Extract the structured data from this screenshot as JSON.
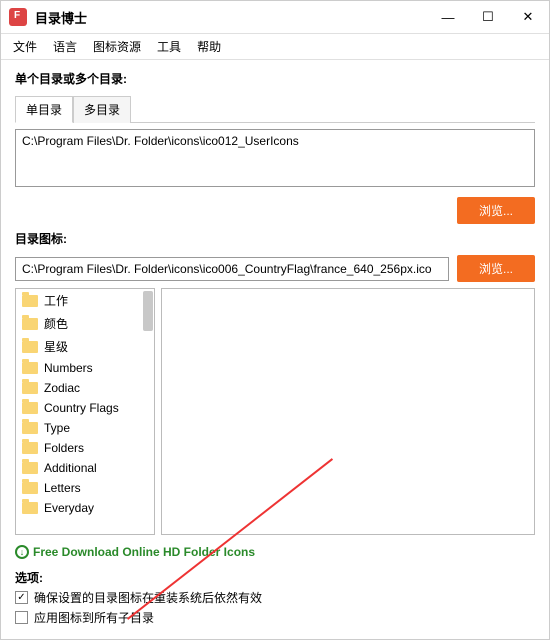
{
  "title": "目录博士",
  "menu": [
    "文件",
    "语言",
    "图标资源",
    "工具",
    "帮助"
  ],
  "section1_label": "单个目录或多个目录:",
  "tabs": [
    "单目录",
    "多目录"
  ],
  "path_input": "C:\\Program Files\\Dr. Folder\\icons\\ico012_UserIcons",
  "browse_label": "浏览...",
  "section2_label": "目录图标:",
  "icon_path": "C:\\Program Files\\Dr. Folder\\icons\\ico006_CountryFlag\\france_640_256px.ico",
  "categories": [
    "工作",
    "颜色",
    "星级",
    "Numbers",
    "Zodiac",
    "Country Flags",
    "Type",
    "Folders",
    "Additional",
    "Letters",
    "Everyday"
  ],
  "download_link": "Free Download Online HD Folder Icons",
  "options_label": "选项:",
  "opt1": "确保设置的目录图标在重装系统后依然有效",
  "opt2": "应用图标到所有子目录",
  "opt1_checked": true,
  "opt2_checked": false
}
